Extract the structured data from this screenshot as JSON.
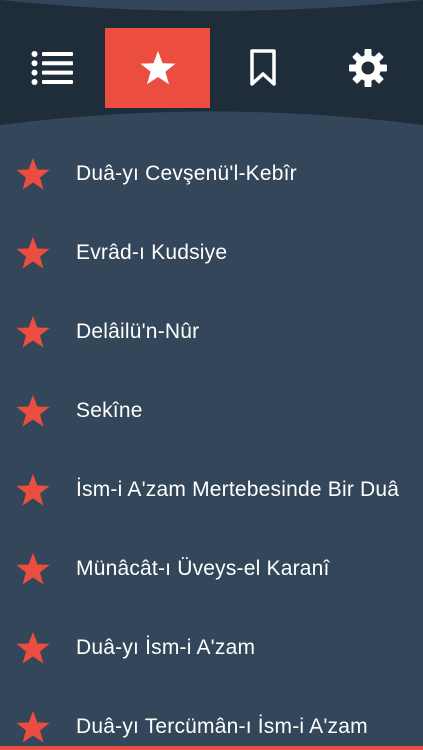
{
  "nav": {
    "tabs": [
      {
        "id": "menu",
        "icon": "list-icon",
        "active": false
      },
      {
        "id": "favorites",
        "icon": "star-icon",
        "active": true
      },
      {
        "id": "bookmarks",
        "icon": "bookmark-icon",
        "active": false
      },
      {
        "id": "settings",
        "icon": "gear-icon",
        "active": false
      }
    ]
  },
  "favorites": {
    "items": [
      {
        "label": "Duâ-yı Cevşenü'l-Kebîr"
      },
      {
        "label": "Evrâd-ı Kudsiye"
      },
      {
        "label": "Delâilü'n-Nûr"
      },
      {
        "label": "Sekîne"
      },
      {
        "label": "İsm-i A'zam Mertebesinde Bir Duâ"
      },
      {
        "label": "Münâcât-ı Üveys-el Karanî"
      },
      {
        "label": "Duâ-yı İsm-i A'zam"
      },
      {
        "label": "Duâ-yı Tercümân-ı İsm-i A'zam"
      }
    ]
  },
  "colors": {
    "background": "#34465a",
    "header_dark": "#1f2d3b",
    "accent": "#eb4d3f",
    "text": "#ffffff"
  }
}
